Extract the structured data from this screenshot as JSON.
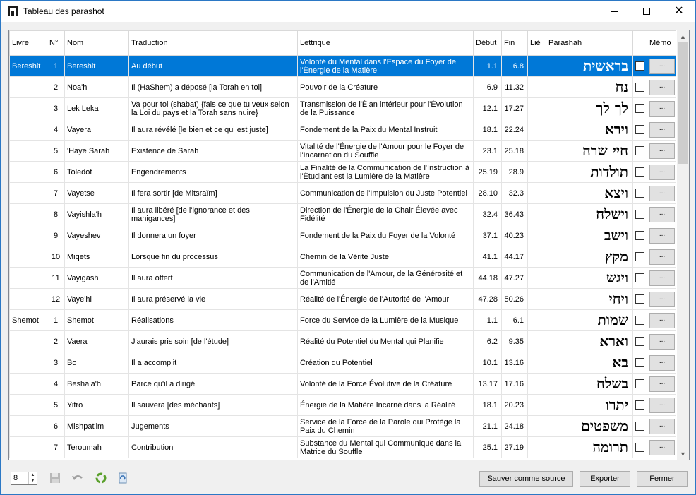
{
  "window": {
    "title": "Tableau des parashot"
  },
  "columns": [
    "Livre",
    "N°",
    "Nom",
    "Traduction",
    "Lettrique",
    "Début",
    "Fin",
    "Lié",
    "Parashah",
    "",
    "Mémo"
  ],
  "rows": [
    {
      "livre": "Bereshit",
      "n": "1",
      "nom": "Bereshit",
      "trad": "Au début",
      "lett": "Volonté du Mental dans l'Espace du Foyer de l'Énergie de la Matière",
      "debut": "1.1",
      "fin": "6.8",
      "heb": "בראשית",
      "selected": true
    },
    {
      "livre": "",
      "n": "2",
      "nom": "Noa'h",
      "trad": "Il (HaShem) a déposé [la Torah en toi]",
      "lett": "Pouvoir de la Créature",
      "debut": "6.9",
      "fin": "11.32",
      "heb": "נח"
    },
    {
      "livre": "",
      "n": "3",
      "nom": "Lek Leka",
      "trad": "Va pour toi (shabat) {fais ce que tu veux selon la Loi du pays et la Torah sans nuire}",
      "lett": "Transmission de l'Élan intérieur pour l'Évolution de la Puissance",
      "debut": "12.1",
      "fin": "17.27",
      "heb": "לך לך"
    },
    {
      "livre": "",
      "n": "4",
      "nom": "Vayera",
      "trad": "Il aura révélé [le bien et ce qui est juste]",
      "lett": "Fondement de la Paix du Mental Instruit",
      "debut": "18.1",
      "fin": "22.24",
      "heb": "וירא"
    },
    {
      "livre": "",
      "n": "5",
      "nom": "'Haye Sarah",
      "trad": "Existence de Sarah",
      "lett": "Vitalité de l'Énergie de l'Amour pour le Foyer de l'Incarnation du Souffle",
      "debut": "23.1",
      "fin": "25.18",
      "heb": "חיי שרה"
    },
    {
      "livre": "",
      "n": "6",
      "nom": "Toledot",
      "trad": "Engendrements",
      "lett": "La Finalité de la Communication de l'Instruction à l'Étudiant est la Lumière de la Matière",
      "debut": "25.19",
      "fin": "28.9",
      "heb": "תולדות"
    },
    {
      "livre": "",
      "n": "7",
      "nom": "Vayetse",
      "trad": "Il fera sortir [de Mitsraïm]",
      "lett": "Communication de l'Impulsion du Juste Potentiel",
      "debut": "28.10",
      "fin": "32.3",
      "heb": "ויצא"
    },
    {
      "livre": "",
      "n": "8",
      "nom": "Vayishla'h",
      "trad": "Il aura libéré [de l'ignorance et des manigances]",
      "lett": "Direction de l'Énergie de la Chair Élevée avec Fidélité",
      "debut": "32.4",
      "fin": "36.43",
      "heb": "וישלח"
    },
    {
      "livre": "",
      "n": "9",
      "nom": "Vayeshev",
      "trad": "Il donnera un foyer",
      "lett": "Fondement de la Paix du Foyer de la Volonté",
      "debut": "37.1",
      "fin": "40.23",
      "heb": "וישב"
    },
    {
      "livre": "",
      "n": "10",
      "nom": "Miqets",
      "trad": "Lorsque fin du processus",
      "lett": "Chemin de la Vérité Juste",
      "debut": "41.1",
      "fin": "44.17",
      "heb": "מקץ"
    },
    {
      "livre": "",
      "n": "11",
      "nom": "Vayigash",
      "trad": "Il aura offert",
      "lett": "Communication de l'Amour, de la Générosité et de l'Amitié",
      "debut": "44.18",
      "fin": "47.27",
      "heb": "ויגש"
    },
    {
      "livre": "",
      "n": "12",
      "nom": "Vaye'hi",
      "trad": "Il aura préservé la vie",
      "lett": "Réalité de l'Énergie de l'Autorité de l'Amour",
      "debut": "47.28",
      "fin": "50.26",
      "heb": "ויחי"
    },
    {
      "livre": "Shemot",
      "n": "1",
      "nom": "Shemot",
      "trad": "Réalisations",
      "lett": "Force du Service de la Lumière de la Musique",
      "debut": "1.1",
      "fin": "6.1",
      "heb": "שמות"
    },
    {
      "livre": "",
      "n": "2",
      "nom": "Vaera",
      "trad": "J'aurais pris soin [de l'étude]",
      "lett": "Réalité du Potentiel du Mental qui Planifie",
      "debut": "6.2",
      "fin": "9.35",
      "heb": "וארא"
    },
    {
      "livre": "",
      "n": "3",
      "nom": "Bo",
      "trad": "Il a accomplit",
      "lett": "Création du Potentiel",
      "debut": "10.1",
      "fin": "13.16",
      "heb": "בא"
    },
    {
      "livre": "",
      "n": "4",
      "nom": "Beshala'h",
      "trad": "Parce qu'il a dirigé",
      "lett": "Volonté de la Force Évolutive de la Créature",
      "debut": "13.17",
      "fin": "17.16",
      "heb": "בשלח"
    },
    {
      "livre": "",
      "n": "5",
      "nom": "Yitro",
      "trad": "Il sauvera [des méchants]",
      "lett": "Énergie de la Matière Incarné dans la Réalité",
      "debut": "18.1",
      "fin": "20.23",
      "heb": "יתרו"
    },
    {
      "livre": "",
      "n": "6",
      "nom": "Mishpat'im",
      "trad": "Jugements",
      "lett": "Service de la Force de la Parole qui Protège la Paix du Chemin",
      "debut": "21.1",
      "fin": "24.18",
      "heb": "משפטים"
    },
    {
      "livre": "",
      "n": "7",
      "nom": "Teroumah",
      "trad": "Contribution",
      "lett": "Substance du Mental qui Communique dans la Matrice du Souffle",
      "debut": "25.1",
      "fin": "27.19",
      "heb": "תרומה"
    }
  ],
  "memo_label": "...",
  "bottom": {
    "spinner_value": "8",
    "save_source": "Sauver comme source",
    "export": "Exporter",
    "close": "Fermer"
  }
}
